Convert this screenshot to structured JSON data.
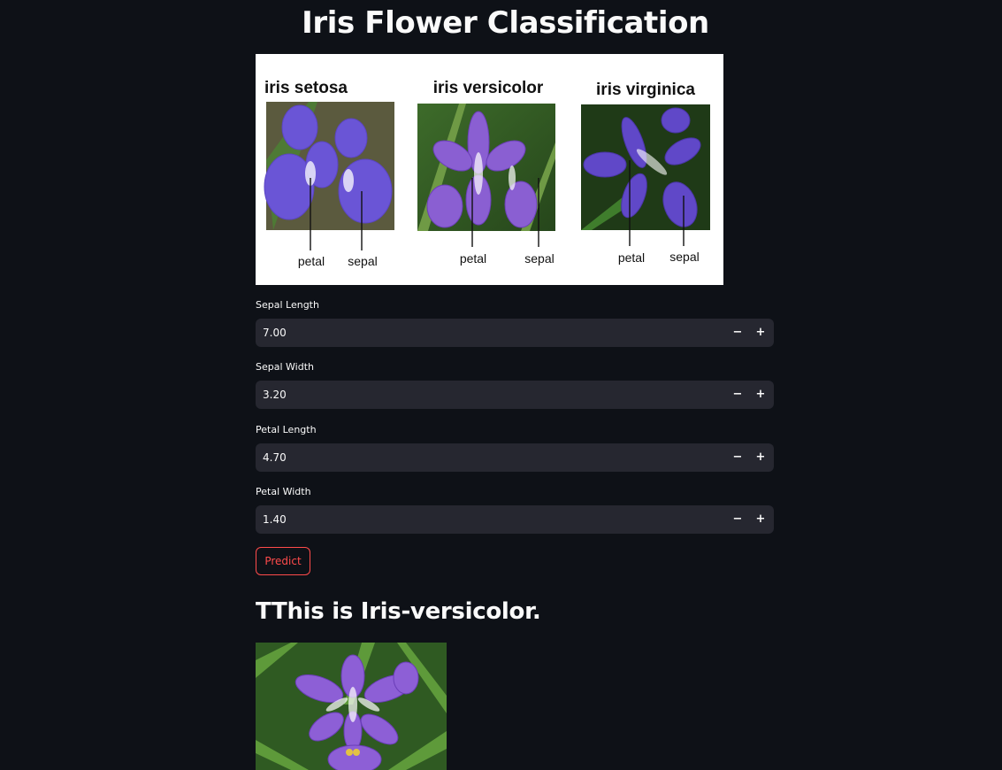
{
  "page": {
    "title": "Iris Flower Classification"
  },
  "hero_image": {
    "species": [
      {
        "name": "iris setosa",
        "petal_label": "petal",
        "sepal_label": "sepal"
      },
      {
        "name": "iris versicolor",
        "petal_label": "petal",
        "sepal_label": "sepal"
      },
      {
        "name": "iris virginica",
        "petal_label": "petal",
        "sepal_label": "sepal"
      }
    ]
  },
  "inputs": [
    {
      "label": "Sepal Length",
      "value": "7.00"
    },
    {
      "label": "Sepal Width",
      "value": "3.20"
    },
    {
      "label": "Petal Length",
      "value": "4.70"
    },
    {
      "label": "Petal Width",
      "value": "1.40"
    }
  ],
  "stepper_icons": {
    "decrement": "minus-icon",
    "increment": "plus-icon"
  },
  "stepper_glyphs": {
    "decrement": "−",
    "increment": "+"
  },
  "predict_button": {
    "label": "Predict"
  },
  "result": {
    "text": "TThis is Iris-versicolor."
  },
  "colors": {
    "background": "#0e1117",
    "input_background": "#262730",
    "accent": "#ff4b4b",
    "text": "#fafafa"
  }
}
